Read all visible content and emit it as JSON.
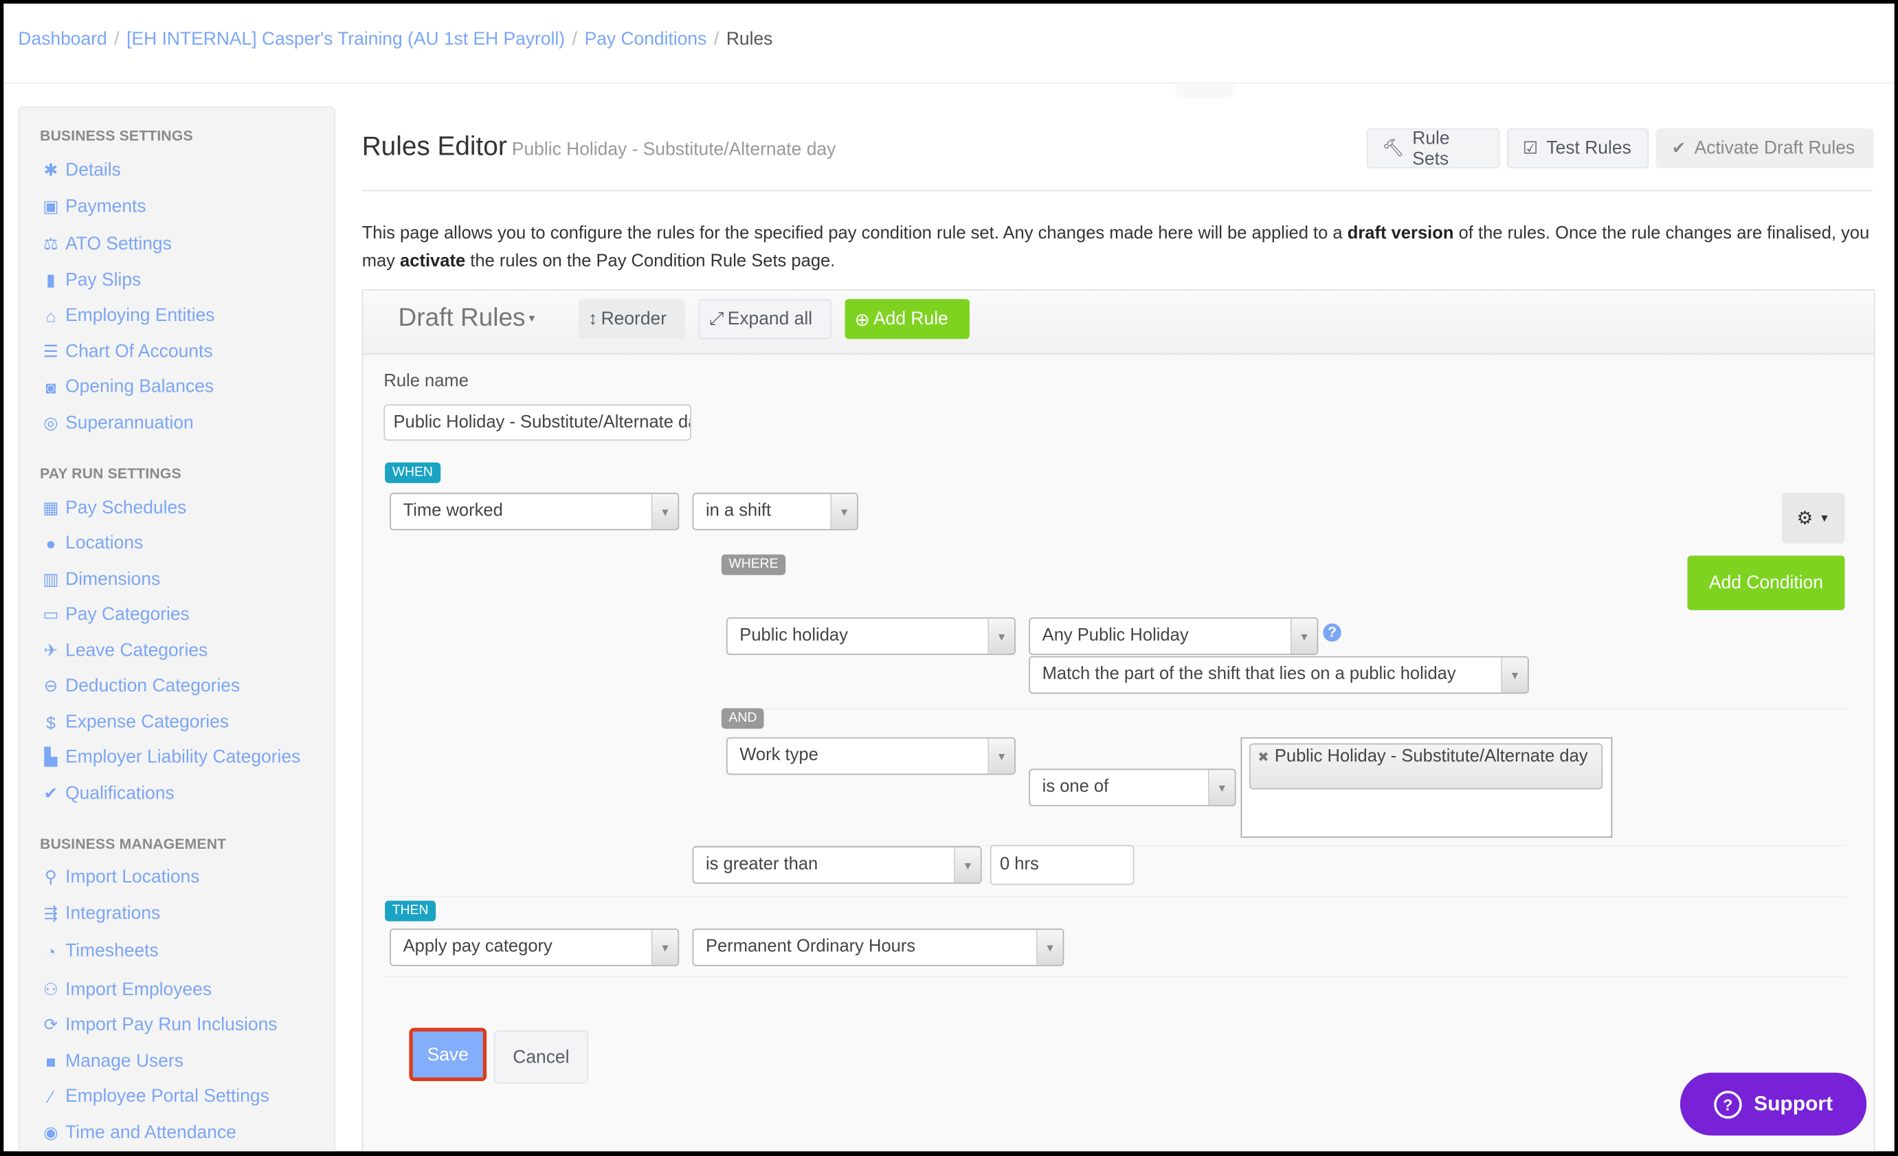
{
  "breadcrumb": [
    {
      "label": "Dashboard",
      "current": false
    },
    {
      "label": "[EH INTERNAL] Casper's Training (AU 1st EH Payroll)",
      "current": false
    },
    {
      "label": "Pay Conditions",
      "current": false
    },
    {
      "label": "Rules",
      "current": true
    }
  ],
  "breadcrumb_separator": "/",
  "sidebar": {
    "sections": [
      {
        "heading": "BUSINESS SETTINGS",
        "items": [
          {
            "label": "Details",
            "icon": "gear-icon"
          },
          {
            "label": "Payments",
            "icon": "floppy-icon"
          },
          {
            "label": "ATO Settings",
            "icon": "scale-icon"
          },
          {
            "label": "Pay Slips",
            "icon": "file-icon"
          },
          {
            "label": "Employing Entities",
            "icon": "bank-icon"
          },
          {
            "label": "Chart Of Accounts",
            "icon": "list-icon"
          },
          {
            "label": "Opening Balances",
            "icon": "wallet-icon"
          },
          {
            "label": "Superannuation",
            "icon": "lifebuoy-icon"
          }
        ]
      },
      {
        "heading": "PAY RUN SETTINGS",
        "items": [
          {
            "label": "Pay Schedules",
            "icon": "calendar-icon"
          },
          {
            "label": "Locations",
            "icon": "globe-icon"
          },
          {
            "label": "Dimensions",
            "icon": "bar-chart-icon"
          },
          {
            "label": "Pay Categories",
            "icon": "money-icon"
          },
          {
            "label": "Leave Categories",
            "icon": "plane-icon"
          },
          {
            "label": "Deduction Categories",
            "icon": "minus-circle-icon"
          },
          {
            "label": "Expense Categories",
            "icon": "dollar-circle-icon"
          },
          {
            "label": "Employer Liability Categories",
            "icon": "factory-icon"
          },
          {
            "label": "Qualifications",
            "icon": "check-icon"
          }
        ]
      },
      {
        "heading": "BUSINESS MANAGEMENT",
        "items": [
          {
            "label": "Import Locations",
            "icon": "map-pin-icon"
          },
          {
            "label": "Integrations",
            "icon": "integration-icon"
          },
          {
            "label": "Timesheets",
            "icon": "clock-icon"
          },
          {
            "label": "Import Employees",
            "icon": "people-icon"
          },
          {
            "label": "Import Pay Run Inclusions",
            "icon": "refresh-icon"
          },
          {
            "label": "Manage Users",
            "icon": "lock-icon"
          },
          {
            "label": "Employee Portal Settings",
            "icon": "magic-wand-icon"
          },
          {
            "label": "Time and Attendance",
            "icon": "user-circle-icon"
          }
        ]
      }
    ]
  },
  "header": {
    "title": "Rules Editor",
    "subtitle": "Public Holiday - Substitute/Alternate day",
    "buttons": {
      "rule_sets": "Rule Sets",
      "test_rules": "Test Rules",
      "activate": "Activate Draft Rules"
    }
  },
  "description": {
    "part1": "This page allows you to configure the rules for the specified pay condition rule set. Any changes made here will be applied to a ",
    "bold1": "draft version",
    "part2": " of the rules. Once the rule changes are finalised, you may ",
    "bold2": "activate",
    "part3": " the rules on the Pay Condition Rule Sets page."
  },
  "panel": {
    "title": "Draft Rules",
    "reorder": "Reorder",
    "expand_all": "Expand all",
    "add_rule": "Add Rule"
  },
  "rule": {
    "name_label": "Rule name",
    "name_value": "Public Holiday - Substitute/Alternate day",
    "when_tag": "WHEN",
    "where_tag": "WHERE",
    "and_tag": "AND",
    "then_tag": "THEN",
    "when_subject": "Time worked",
    "when_scope": "in a shift",
    "cond1_field": "Public holiday",
    "cond1_value": "Any Public Holiday",
    "cond1_match": "Match the part of the shift that lies on a public holiday",
    "cond2_field": "Work type",
    "cond2_operator": "is one of",
    "cond2_values": [
      "Public Holiday - Substitute/Alternate day"
    ],
    "comparison": "is greater than",
    "comparison_value": "0 hrs",
    "then_action": "Apply pay category",
    "then_value": "Permanent Ordinary Hours",
    "add_condition": "Add Condition",
    "help": "?"
  },
  "actions": {
    "save": "Save",
    "cancel": "Cancel"
  },
  "support": {
    "label": "Support",
    "icon": "?"
  },
  "colors": {
    "link": "#7ba6f5",
    "green": "#7ed321",
    "teal": "#1ba3c4",
    "support": "#7722d6",
    "highlight": "#e03a1a"
  }
}
